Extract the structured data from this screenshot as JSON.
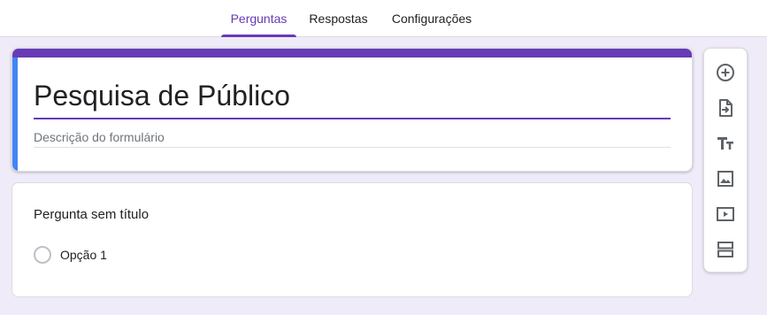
{
  "tabs": {
    "questions": "Perguntas",
    "responses": "Respostas",
    "settings": "Configurações",
    "active": "questions"
  },
  "form": {
    "title": "Pesquisa de Público",
    "description_placeholder": "Descrição do formulário"
  },
  "question": {
    "title": "Pergunta sem título",
    "options": [
      "Opção 1"
    ]
  },
  "toolbar": {
    "tools": [
      {
        "icon": "add-question-icon"
      },
      {
        "icon": "import-questions-icon"
      },
      {
        "icon": "add-title-icon"
      },
      {
        "icon": "add-image-icon"
      },
      {
        "icon": "add-video-icon"
      },
      {
        "icon": "add-section-icon"
      }
    ]
  },
  "colors": {
    "accent": "#673ab7",
    "left_accent": "#4285f4",
    "background": "#f0ebf8",
    "icon": "#5f6368"
  }
}
